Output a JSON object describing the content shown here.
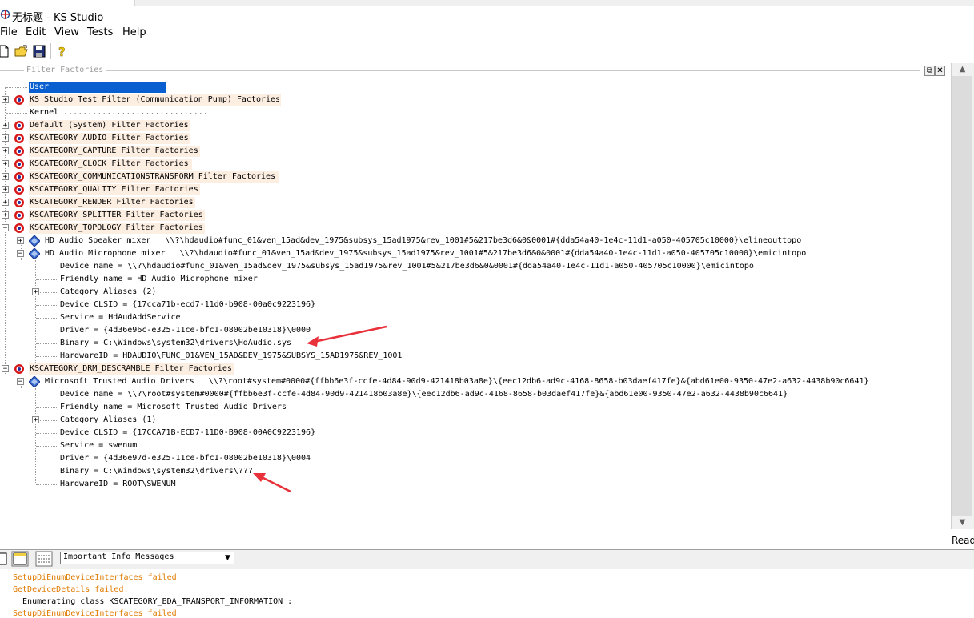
{
  "window": {
    "title": "无标题 - KS Studio"
  },
  "menu": {
    "items": [
      "File",
      "Edit",
      "View",
      "Tests",
      "Help"
    ]
  },
  "toolbar": {
    "buttons": [
      "new-icon",
      "open-icon",
      "save-icon",
      "help-icon"
    ]
  },
  "panel": {
    "title": "Filter Factories",
    "restore_glyph": "⧉",
    "close_glyph": "✕"
  },
  "tree": {
    "rows": [
      "User",
      "KS Studio Test Filter (Communication Pump) Factories",
      "Kernel ..............................",
      "Default (System) Filter Factories",
      "KSCATEGORY_AUDIO Filter Factories",
      "KSCATEGORY_CAPTURE Filter Factories",
      "KSCATEGORY_CLOCK Filter Factories",
      "KSCATEGORY_COMMUNICATIONSTRANSFORM Filter Factories",
      "KSCATEGORY_QUALITY Filter Factories",
      "KSCATEGORY_RENDER Filter Factories",
      "KSCATEGORY_SPLITTER Filter Factories",
      "KSCATEGORY_TOPOLOGY Filter Factories",
      "HD Audio Speaker mixer   \\\\?\\hdaudio#func_01&ven_15ad&dev_1975&subsys_15ad1975&rev_1001#5&217be3d6&0&0001#{dda54a40-1e4c-11d1-a050-405705c10000}\\elineouttopo",
      "HD Audio Microphone mixer   \\\\?\\hdaudio#func_01&ven_15ad&dev_1975&subsys_15ad1975&rev_1001#5&217be3d6&0&0001#{dda54a40-1e4c-11d1-a050-405705c10000}\\emicintopo",
      "Device name = \\\\?\\hdaudio#func_01&ven_15ad&dev_1975&subsys_15ad1975&rev_1001#5&217be3d6&0&0001#{dda54a40-1e4c-11d1-a050-405705c10000}\\emicintopo",
      "Friendly name = HD Audio Microphone mixer",
      "Category Aliases (2)",
      "Device CLSID = {17cca71b-ecd7-11d0-b908-00a0c9223196}",
      "Service = HdAudAddService",
      "Driver = {4d36e96c-e325-11ce-bfc1-08002be10318}\\0000",
      "Binary = C:\\Windows\\system32\\drivers\\HdAudio.sys",
      "HardwareID = HDAUDIO\\FUNC_01&VEN_15AD&DEV_1975&SUBSYS_15AD1975&REV_1001",
      "KSCATEGORY_DRM_DESCRAMBLE Filter Factories",
      "Microsoft Trusted Audio Drivers   \\\\?\\root#system#0000#{ffbb6e3f-ccfe-4d84-90d9-421418b03a8e}\\{eec12db6-ad9c-4168-8658-b03daef417fe}&{abd61e00-9350-47e2-a632-4438b90c6641}",
      "Device name = \\\\?\\root#system#0000#{ffbb6e3f-ccfe-4d84-90d9-421418b03a8e}\\{eec12db6-ad9c-4168-8658-b03daef417fe}&{abd61e00-9350-47e2-a632-4438b90c6641}",
      "Friendly name = Microsoft Trusted Audio Drivers",
      "Category Aliases (1)",
      "Device CLSID = {17CCA71B-ECD7-11D0-B908-00A0C9223196}",
      "Service = swenum",
      "Driver = {4d36e97d-e325-11ce-bfc1-08002be10318}\\0004",
      "Binary = C:\\Windows\\system32\\drivers\\???",
      "HardwareID = ROOT\\SWENUM"
    ]
  },
  "scrollbar": {
    "up_glyph": "▲",
    "down_glyph": "▼"
  },
  "status": {
    "read_label": "Read"
  },
  "log": {
    "filter_value": "Important Info Messages",
    "dropdown_glyph": "▼",
    "lines": [
      "SetupDiEnumDeviceInterfaces failed",
      "GetDeviceDetails failed.",
      "  Enumerating class KSCATEGORY_BDA_TRANSPORT_INFORMATION :",
      "SetupDiEnumDeviceInterfaces failed"
    ]
  },
  "colors": {
    "selection": "#0a5fd0",
    "row_highlight": "#fdeee2",
    "log_warning": "#e07a00",
    "annotation_arrow": "#e8313b"
  }
}
